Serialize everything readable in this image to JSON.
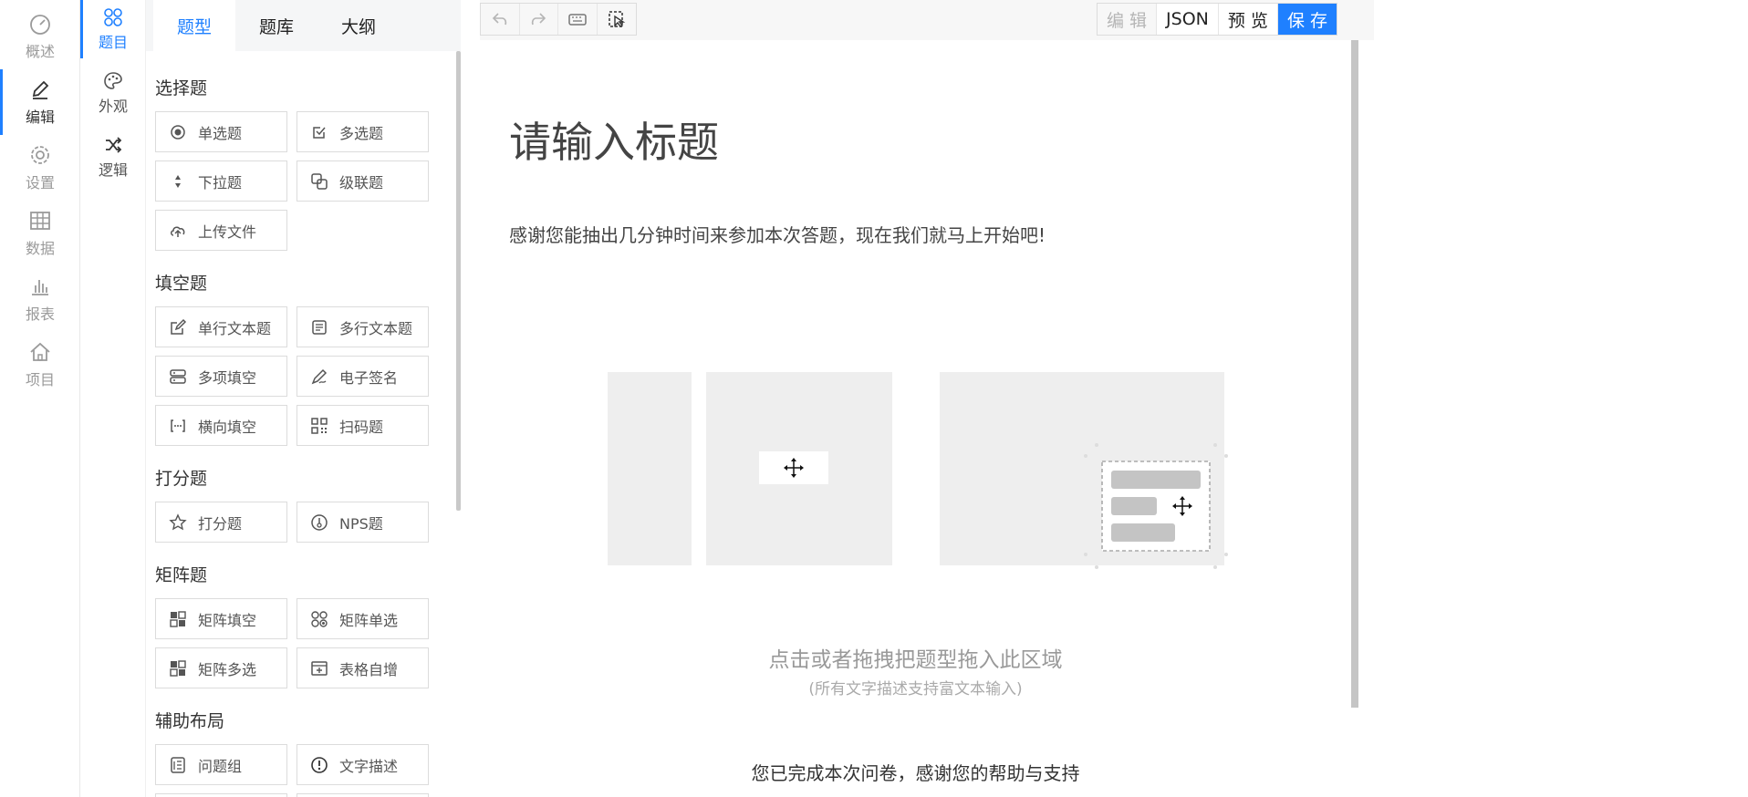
{
  "leftnav": [
    {
      "label": "概述",
      "icon": "dashboard-icon"
    },
    {
      "label": "编辑",
      "icon": "edit-icon"
    },
    {
      "label": "设置",
      "icon": "gear-icon"
    },
    {
      "label": "数据",
      "icon": "table-icon"
    },
    {
      "label": "报表",
      "icon": "bar-chart-icon"
    },
    {
      "label": "项目",
      "icon": "home-icon"
    }
  ],
  "subnav": [
    {
      "label": "题目",
      "icon": "apps-icon"
    },
    {
      "label": "外观",
      "icon": "palette-icon"
    },
    {
      "label": "逻辑",
      "icon": "shuffle-icon"
    }
  ],
  "panel": {
    "tabs": [
      "题型",
      "题库",
      "大纲"
    ],
    "groups": [
      {
        "title": "选择题",
        "items": [
          {
            "label": "单选题",
            "icon": "radio-icon"
          },
          {
            "label": "多选题",
            "icon": "checkbox-icon"
          },
          {
            "label": "下拉题",
            "icon": "dropdown-icon"
          },
          {
            "label": "级联题",
            "icon": "cascade-icon"
          },
          {
            "label": "上传文件",
            "icon": "upload-icon"
          }
        ]
      },
      {
        "title": "填空题",
        "items": [
          {
            "label": "单行文本题",
            "icon": "pencil-box-icon"
          },
          {
            "label": "多行文本题",
            "icon": "multiline-icon"
          },
          {
            "label": "多项填空",
            "icon": "multi-fill-icon"
          },
          {
            "label": "电子签名",
            "icon": "signature-icon"
          },
          {
            "label": "横向填空",
            "icon": "bracket-fill-icon"
          },
          {
            "label": "扫码题",
            "icon": "qrcode-icon"
          }
        ]
      },
      {
        "title": "打分题",
        "items": [
          {
            "label": "打分题",
            "icon": "star-icon"
          },
          {
            "label": "NPS题",
            "icon": "nps-icon"
          }
        ]
      },
      {
        "title": "矩阵题",
        "items": [
          {
            "label": "矩阵填空",
            "icon": "matrix-fill-icon"
          },
          {
            "label": "矩阵单选",
            "icon": "matrix-radio-icon"
          },
          {
            "label": "矩阵多选",
            "icon": "matrix-checkbox-icon"
          },
          {
            "label": "表格自增",
            "icon": "table-add-icon"
          }
        ]
      },
      {
        "title": "辅助布局",
        "items": [
          {
            "label": "问题组",
            "icon": "group-icon"
          },
          {
            "label": "文字描述",
            "icon": "info-icon"
          }
        ]
      }
    ]
  },
  "toolbar": {
    "tools": [
      "undo-icon",
      "redo-icon",
      "keyboard-icon",
      "cursor-icon"
    ],
    "edit": "编 辑",
    "json": "JSON",
    "preview": "预 览",
    "save": "保 存"
  },
  "survey": {
    "title": "请输入标题",
    "description": "感谢您能抽出几分钟时间来参加本次答题，现在我们就马上开始吧!",
    "empty_main": "点击或者拖拽把题型拖入此区域",
    "empty_sub": "(所有文字描述支持富文本输入)",
    "finish": "您已完成本次问卷，感谢您的帮助与支持"
  },
  "colors": {
    "primary": "#1f80ff",
    "panel_bg": "#f5f6f7",
    "placeholder": "#eeeeee"
  }
}
